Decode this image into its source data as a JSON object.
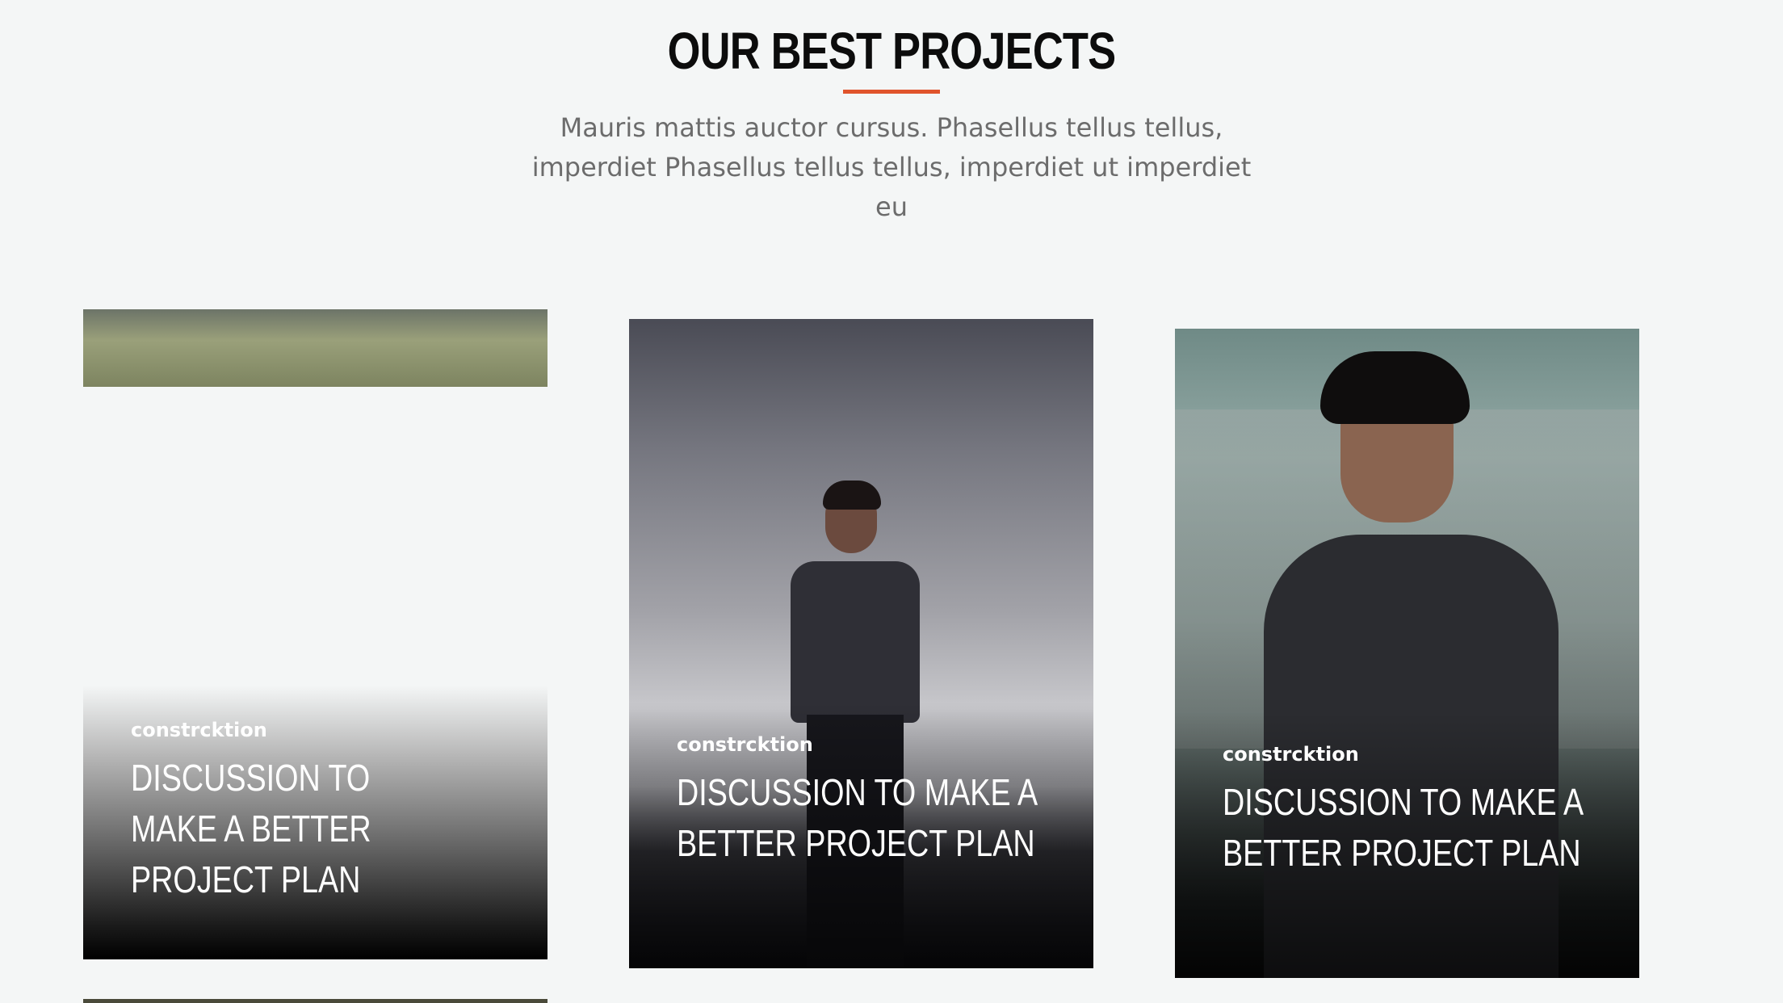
{
  "section": {
    "title": "OUR BEST PROJECTS",
    "subtitle": "Mauris mattis auctor cursus. Phasellus tellus tellus, imperdiet Phasellus tellus tellus, imperdiet ut imperdiet eu",
    "accent_color": "#e0542c",
    "background_color": "#f4f6f6"
  },
  "projects": [
    {
      "category": "constrcktion",
      "title": "DISCUSSION TO MAKE A BETTER PROJECT PLAN"
    },
    {
      "category": "constrcktion",
      "title": "DISCUSSION TO MAKE A BETTER PROJECT PLAN"
    },
    {
      "category": "constrcktion",
      "title": "DISCUSSION TO MAKE A BETTER PROJECT PLAN"
    }
  ]
}
